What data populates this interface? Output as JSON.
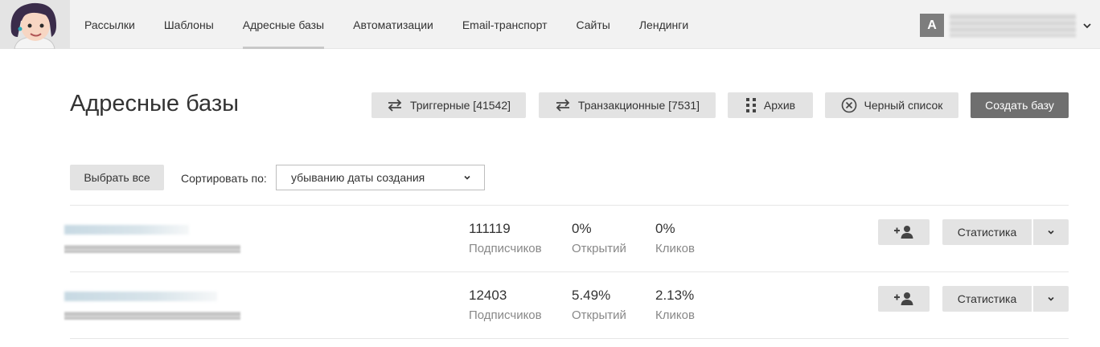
{
  "nav": {
    "items": [
      {
        "label": "Рассылки",
        "active": false
      },
      {
        "label": "Шаблоны",
        "active": false
      },
      {
        "label": "Адресные базы",
        "active": true
      },
      {
        "label": "Автоматизации",
        "active": false
      },
      {
        "label": "Email-транспорт",
        "active": false
      },
      {
        "label": "Сайты",
        "active": false
      },
      {
        "label": "Лендинги",
        "active": false
      }
    ]
  },
  "user": {
    "initial": "A"
  },
  "header": {
    "title": "Адресные базы",
    "triggered_label": "Триггерные [41542]",
    "transactional_label": "Транзакционные [7531]",
    "archive_label": "Архив",
    "blacklist_label": "Черный список",
    "create_label": "Создать базу"
  },
  "controls": {
    "select_all_label": "Выбрать все",
    "sort_label": "Сортировать по:",
    "sort_value": "убыванию даты создания"
  },
  "rows": [
    {
      "subscribers": "111119",
      "subscribers_label": "Подписчиков",
      "opens": "0%",
      "opens_label": "Открытий",
      "clicks": "0%",
      "clicks_label": "Кликов",
      "stats_label": "Статистика"
    },
    {
      "subscribers": "12403",
      "subscribers_label": "Подписчиков",
      "opens": "5.49%",
      "opens_label": "Открытий",
      "clicks": "2.13%",
      "clicks_label": "Кликов",
      "stats_label": "Статистика"
    }
  ],
  "colors": {
    "primary_button": "#6f6f6f",
    "button_bg": "#e3e3e3",
    "topbar_bg": "#f2f2f2",
    "muted_text": "#888888"
  },
  "icons": [
    "swap-arrows-icon",
    "grid-dots-icon",
    "circle-x-icon",
    "add-user-icon",
    "chevron-down-icon"
  ]
}
